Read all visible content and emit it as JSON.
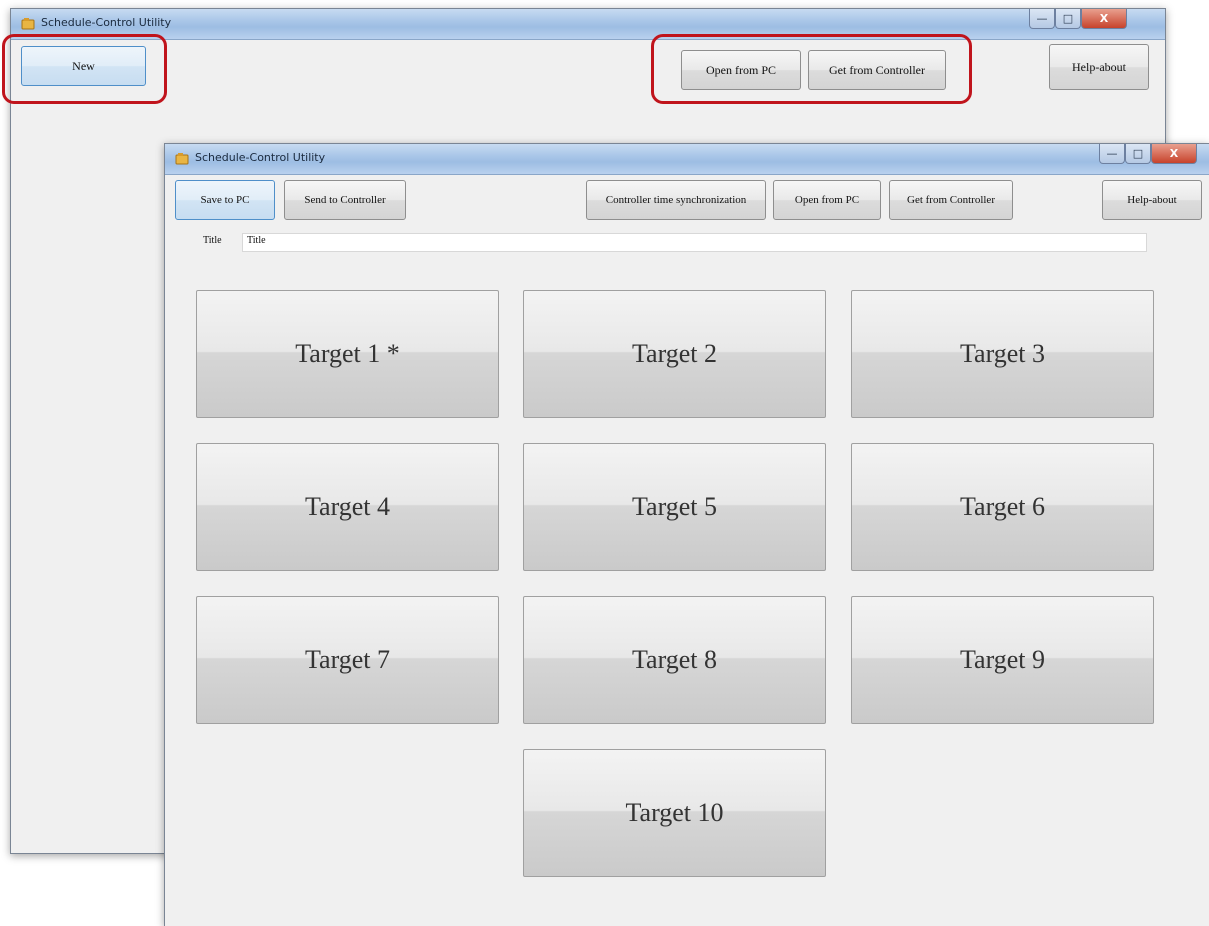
{
  "back_window": {
    "title": "Schedule-Control Utility",
    "controls": {
      "minimize": "—",
      "maximize": "□",
      "close": "X"
    },
    "buttons": {
      "new": "New",
      "open_from_pc": "Open from PC",
      "get_from_controller": "Get from Controller",
      "help_about": "Help-about"
    }
  },
  "front_window": {
    "title": "Schedule-Control Utility",
    "controls": {
      "minimize": "—",
      "maximize": "□",
      "close": "X"
    },
    "buttons": {
      "save_to_pc": "Save to PC",
      "send_to_controller": "Send to Controller",
      "time_sync": "Controller time synchronization",
      "open_from_pc": "Open from PC",
      "get_from_controller": "Get from Controller",
      "help_about": "Help-about"
    },
    "title_field": {
      "label": "Title",
      "value": "Title"
    },
    "targets": [
      "Target 1 *",
      "Target 2",
      "Target 3",
      "Target 4",
      "Target 5",
      "Target 6",
      "Target 7",
      "Target 8",
      "Target 9",
      "Target 10"
    ]
  },
  "colors": {
    "highlight": "#c0141c",
    "window_bg": "#f0f0f0"
  }
}
